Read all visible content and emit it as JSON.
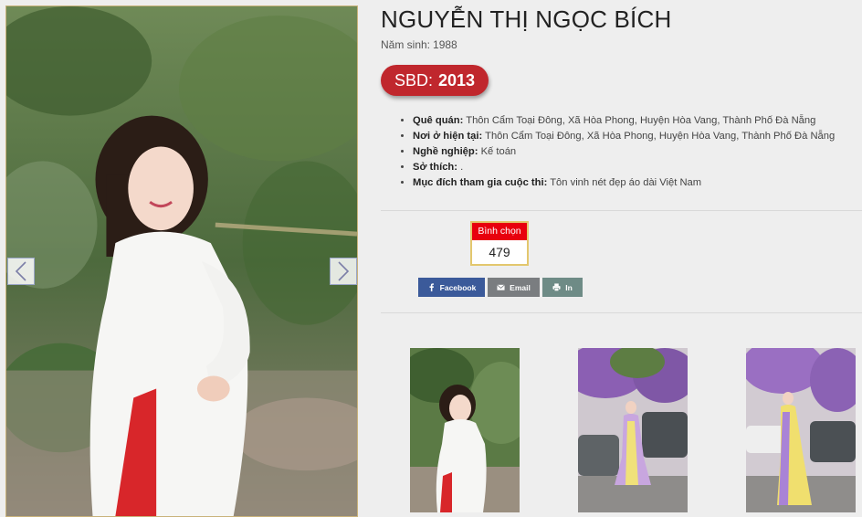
{
  "contestant": {
    "name": "NGUYỄN THỊ NGỌC BÍCH",
    "birth_label": "Năm sinh:",
    "birth_year": "1988",
    "sbd_label": "SBD:",
    "sbd_number": "2013"
  },
  "info": [
    {
      "label": "Quê quán:",
      "value": "Thôn Cẩm Toại Đông, Xã Hòa Phong, Huyện Hòa Vang, Thành Phố Đà Nẵng"
    },
    {
      "label": "Nơi ở hiện tại:",
      "value": "Thôn Cẩm Toại Đông, Xã Hòa Phong, Huyện Hòa Vang, Thành Phố Đà Nẵng"
    },
    {
      "label": "Nghề nghiệp:",
      "value": "Kế toán"
    },
    {
      "label": "Sở thích:",
      "value": "."
    },
    {
      "label": "Mục đích tham gia cuộc thi:",
      "value": "Tôn vinh nét đẹp áo dài Việt Nam"
    }
  ],
  "vote": {
    "label": "Bình chọn",
    "count": "479"
  },
  "share": {
    "facebook": "Facebook",
    "email": "Email",
    "print": "In"
  },
  "icons": {
    "prev": "chevron-left-icon",
    "next": "chevron-right-icon",
    "facebook": "facebook-icon",
    "email": "envelope-icon",
    "print": "printer-icon"
  },
  "colors": {
    "sbd_badge": "#c0272d",
    "vote_header": "#e8000d",
    "facebook": "#3b5a9a",
    "email": "#7a7d80",
    "print": "#6e8b86"
  }
}
